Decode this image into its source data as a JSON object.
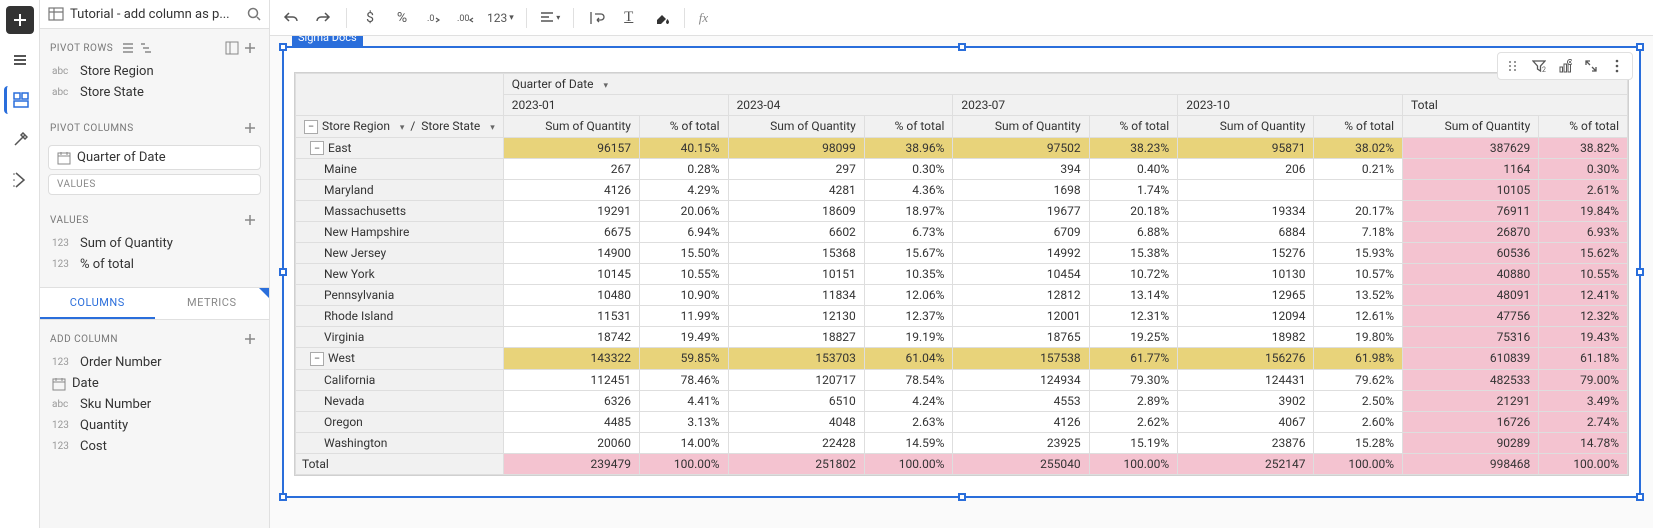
{
  "header": {
    "title": "Tutorial - add column as p..."
  },
  "toolbar": {
    "num_format": "123",
    "fx": "fx"
  },
  "side": {
    "pivot_rows_label": "PIVOT ROWS",
    "pivot_rows": [
      {
        "type": "abc",
        "label": "Store Region"
      },
      {
        "type": "abc",
        "label": "Store State"
      }
    ],
    "pivot_cols_label": "PIVOT COLUMNS",
    "pivot_cols": [
      {
        "type": "date",
        "label": "Quarter of Date"
      }
    ],
    "values_box_label": "VALUES",
    "values_label": "VALUES",
    "values": [
      {
        "type": "123",
        "label": "Sum of Quantity"
      },
      {
        "type": "123",
        "label": "% of total"
      }
    ],
    "tabs": {
      "columns": "COLUMNS",
      "metrics": "METRICS"
    },
    "add_column_label": "ADD COLUMN",
    "add_columns": [
      {
        "type": "123",
        "label": "Order Number"
      },
      {
        "type": "date",
        "label": "Date"
      },
      {
        "type": "abc",
        "label": "Sku Number"
      },
      {
        "type": "123",
        "label": "Quantity"
      },
      {
        "type": "123",
        "label": "Cost"
      }
    ]
  },
  "viz": {
    "tag": "Sigma Docs",
    "col_group_header": "Quarter of Date",
    "quarters": [
      "2023-01",
      "2023-04",
      "2023-07",
      "2023-10"
    ],
    "total_label": "Total",
    "row_headers": {
      "region": "Store Region",
      "state": "Store State"
    },
    "measure_headers": {
      "sum": "Sum of Quantity",
      "pct": "% of total"
    }
  },
  "chart_data": {
    "type": "table",
    "row_dimensions": [
      "Store Region",
      "Store State"
    ],
    "col_dimension": "Quarter of Date",
    "col_values": [
      "2023-01",
      "2023-04",
      "2023-07",
      "2023-10"
    ],
    "measures": [
      "Sum of Quantity",
      "% of total"
    ],
    "groups": [
      {
        "region": "East",
        "totals": {
          "q": [
            "96157",
            "98099",
            "97502",
            "95871"
          ],
          "p": [
            "40.15%",
            "38.96%",
            "38.23%",
            "38.02%"
          ],
          "tq": "387629",
          "tp": "38.82%"
        },
        "rows": [
          {
            "state": "Maine",
            "q": [
              "267",
              "297",
              "394",
              "206"
            ],
            "p": [
              "0.28%",
              "0.30%",
              "0.40%",
              "0.21%"
            ],
            "tq": "1164",
            "tp": "0.30%"
          },
          {
            "state": "Maryland",
            "q": [
              "4126",
              "4281",
              "1698",
              ""
            ],
            "p": [
              "4.29%",
              "4.36%",
              "1.74%",
              ""
            ],
            "tq": "10105",
            "tp": "2.61%"
          },
          {
            "state": "Massachusetts",
            "q": [
              "19291",
              "18609",
              "19677",
              "19334"
            ],
            "p": [
              "20.06%",
              "18.97%",
              "20.18%",
              "20.17%"
            ],
            "tq": "76911",
            "tp": "19.84%"
          },
          {
            "state": "New Hampshire",
            "q": [
              "6675",
              "6602",
              "6709",
              "6884"
            ],
            "p": [
              "6.94%",
              "6.73%",
              "6.88%",
              "7.18%"
            ],
            "tq": "26870",
            "tp": "6.93%"
          },
          {
            "state": "New Jersey",
            "q": [
              "14900",
              "15368",
              "14992",
              "15276"
            ],
            "p": [
              "15.50%",
              "15.67%",
              "15.38%",
              "15.93%"
            ],
            "tq": "60536",
            "tp": "15.62%"
          },
          {
            "state": "New York",
            "q": [
              "10145",
              "10151",
              "10454",
              "10130"
            ],
            "p": [
              "10.55%",
              "10.35%",
              "10.72%",
              "10.57%"
            ],
            "tq": "40880",
            "tp": "10.55%"
          },
          {
            "state": "Pennsylvania",
            "q": [
              "10480",
              "11834",
              "12812",
              "12965"
            ],
            "p": [
              "10.90%",
              "12.06%",
              "13.14%",
              "13.52%"
            ],
            "tq": "48091",
            "tp": "12.41%"
          },
          {
            "state": "Rhode Island",
            "q": [
              "11531",
              "12130",
              "12001",
              "12094"
            ],
            "p": [
              "11.99%",
              "12.37%",
              "12.31%",
              "12.61%"
            ],
            "tq": "47756",
            "tp": "12.32%"
          },
          {
            "state": "Virginia",
            "q": [
              "18742",
              "18827",
              "18765",
              "18982"
            ],
            "p": [
              "19.49%",
              "19.19%",
              "19.25%",
              "19.80%"
            ],
            "tq": "75316",
            "tp": "19.43%"
          }
        ]
      },
      {
        "region": "West",
        "totals": {
          "q": [
            "143322",
            "153703",
            "157538",
            "156276"
          ],
          "p": [
            "59.85%",
            "61.04%",
            "61.77%",
            "61.98%"
          ],
          "tq": "610839",
          "tp": "61.18%"
        },
        "rows": [
          {
            "state": "California",
            "q": [
              "112451",
              "120717",
              "124934",
              "124431"
            ],
            "p": [
              "78.46%",
              "78.54%",
              "79.30%",
              "79.62%"
            ],
            "tq": "482533",
            "tp": "79.00%"
          },
          {
            "state": "Nevada",
            "q": [
              "6326",
              "6510",
              "4553",
              "3902"
            ],
            "p": [
              "4.41%",
              "4.24%",
              "2.89%",
              "2.50%"
            ],
            "tq": "21291",
            "tp": "3.49%"
          },
          {
            "state": "Oregon",
            "q": [
              "4485",
              "4048",
              "4126",
              "4067"
            ],
            "p": [
              "3.13%",
              "2.63%",
              "2.62%",
              "2.60%"
            ],
            "tq": "16726",
            "tp": "2.74%"
          },
          {
            "state": "Washington",
            "q": [
              "20060",
              "22428",
              "23925",
              "23876"
            ],
            "p": [
              "14.00%",
              "14.59%",
              "15.19%",
              "15.28%"
            ],
            "tq": "90289",
            "tp": "14.78%"
          }
        ]
      }
    ],
    "grand_total": {
      "label": "Total",
      "q": [
        "239479",
        "251802",
        "255040",
        "252147"
      ],
      "p": [
        "100.00%",
        "100.00%",
        "100.00%",
        "100.00%"
      ],
      "tq": "998468",
      "tp": "100.00%"
    }
  }
}
